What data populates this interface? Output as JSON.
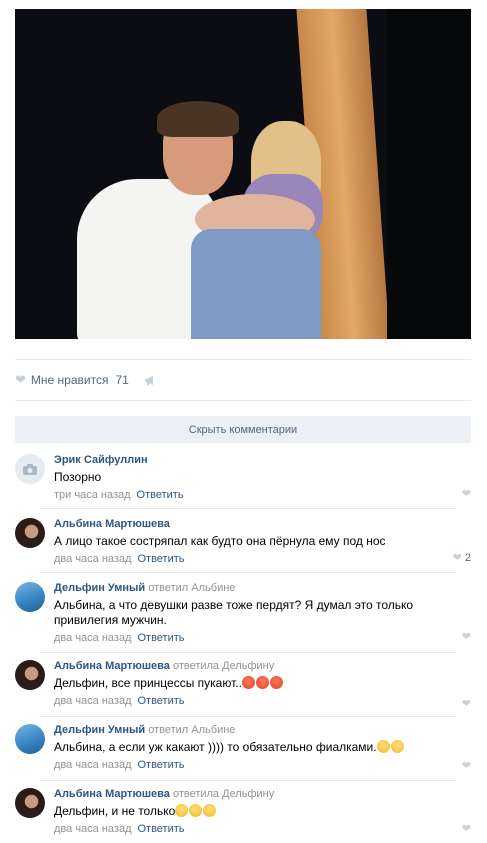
{
  "post": {
    "photo_icon": "photo-image",
    "likes_label": "Мне нравится",
    "likes_count": "71",
    "share_icon": "megaphone-icon",
    "hide_comments": "Скрыть комментарии"
  },
  "comments": [
    {
      "author": "Эрик Сайфуллин",
      "reply_to": "",
      "text": "Позорно",
      "time": "три часа назад",
      "reply_label": "Ответить",
      "likes": "",
      "avatar": "camera-icon"
    },
    {
      "author": "Альбина Мартюшева",
      "reply_to": "",
      "text": "А лицо такое состряпал как будто она пёрнула ему под нос",
      "time": "два часа назад",
      "reply_label": "Ответить",
      "likes": "2",
      "avatar": "photo"
    },
    {
      "author": "Дельфин Умный",
      "reply_to": "ответил Альбине",
      "text": "Альбина, а что девушки разве тоже пердят? Я думал это только привилегия мужчин.",
      "time": "два часа назад",
      "reply_label": "Ответить",
      "likes": "",
      "avatar": "dolphin"
    },
    {
      "author": "Альбина Мартюшева",
      "reply_to": "ответила Дельфину",
      "text": "Дельфин, все принцессы пукают..",
      "time": "два часа назад",
      "reply_label": "Ответить",
      "likes": "",
      "avatar": "photo",
      "emoji": [
        "angry",
        "angry",
        "angry"
      ]
    },
    {
      "author": "Дельфин Умный",
      "reply_to": "ответил Альбине",
      "text": "Альбина, а если уж какают )))) то обязательно фиалками.",
      "time": "два часа назад",
      "reply_label": "Ответить",
      "likes": "",
      "avatar": "dolphin",
      "emoji": [
        "cool",
        "cool"
      ]
    },
    {
      "author": "Альбина Мартюшева",
      "reply_to": "ответила Дельфину",
      "text": "Дельфин, и не только",
      "time": "два часа назад",
      "reply_label": "Ответить",
      "likes": "",
      "avatar": "photo",
      "emoji": [
        "laugh",
        "laugh",
        "laugh"
      ]
    }
  ]
}
